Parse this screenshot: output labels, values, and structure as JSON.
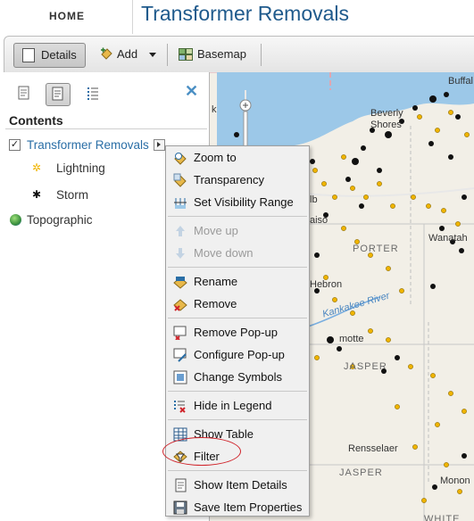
{
  "header": {
    "home": "HOME",
    "title": "Transformer Removals"
  },
  "toolbar": {
    "details": "Details",
    "add": "Add",
    "basemap": "Basemap"
  },
  "pane": {
    "heading": "Contents",
    "layer": {
      "name": "Transformer Removals",
      "checked": "✓"
    },
    "symbols": [
      {
        "label": "Lightning",
        "glyph": "✲",
        "color": "#f0b400"
      },
      {
        "label": "Storm",
        "glyph": "✱",
        "color": "#111111"
      }
    ],
    "basemap_layer": "Topographic"
  },
  "menu": {
    "items": [
      "Zoom to",
      "Transparency",
      "Set Visibility Range",
      "Move up",
      "Move down",
      "Rename",
      "Remove",
      "Remove Pop-up",
      "Configure Pop-up",
      "Change Symbols",
      "Hide in Legend",
      "Show Table",
      "Filter",
      "Show Item Details",
      "Save Item Properties"
    ]
  },
  "map": {
    "labels": {
      "buffalo": "Buffal",
      "beverly": "Beverly",
      "shores": "Shores",
      "k": "k",
      "aiso": "aiso",
      "porter": "PORTER",
      "wanatah": "Wanatah",
      "kouts_river": "Kankakee River",
      "motte": "motte",
      "jasper1": "JASPER",
      "rensselaer": "Rensselaer",
      "jasper2": "JASPER",
      "monon": "Monon",
      "white": "WHITE",
      "hebron": "Hebron",
      "lb": "lb",
      "rville": "rville"
    }
  }
}
